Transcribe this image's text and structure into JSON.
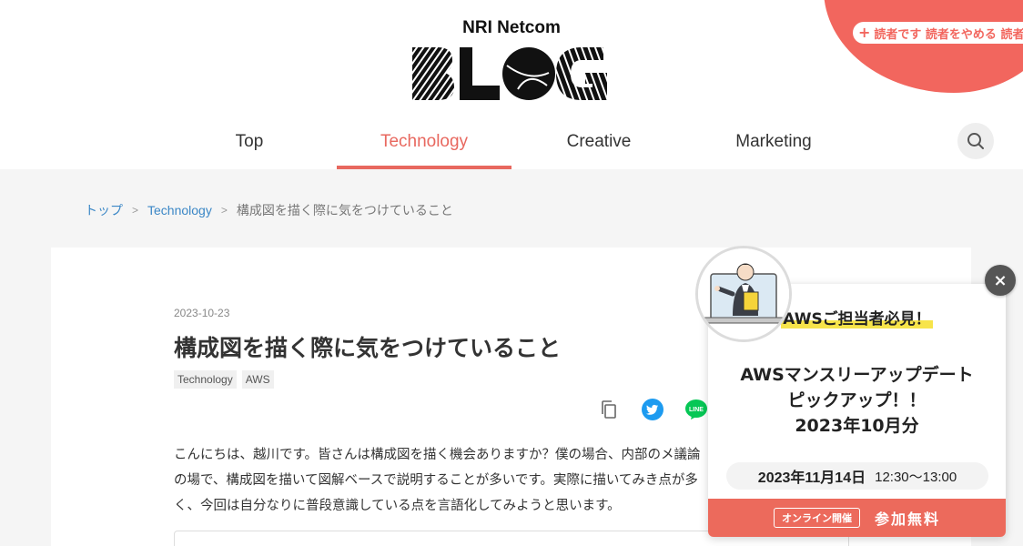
{
  "header": {
    "brand_name": "NRI Netcom",
    "logo_text": "BLOG",
    "reader_button": "読者です 読者をやめる 読者"
  },
  "nav": {
    "items": [
      {
        "label": "Top"
      },
      {
        "label": "Technology",
        "active": true
      },
      {
        "label": "Creative"
      },
      {
        "label": "Marketing"
      }
    ]
  },
  "breadcrumb": {
    "items": [
      "トップ",
      "Technology"
    ],
    "separator": ">",
    "current": "構成図を描く際に気をつけていること"
  },
  "article": {
    "date": "2023-10-23",
    "title": "構成図を描く際に気をつけていること",
    "tags": [
      "Technology",
      "AWS"
    ],
    "body": "こんにちは、越川です。皆さんは構成図を描く機会ありますか？僕の場合、内部のメ議論の場で、構成図を描いて図解ベースで説明することが多いです。実際に描いてみき点が多く、今回は自分なりに普段意識している点を言語化してみようと思います。",
    "share_icons": [
      "copy-icon",
      "twitter-icon",
      "line-icon"
    ],
    "line_label": "LINE"
  },
  "popup": {
    "kicker": "AWSご担当者必見！",
    "title_lines": [
      "AWSマンスリーアップデート",
      "ピックアップ！！",
      "2023年10月分"
    ],
    "date": "2023年11月14日",
    "time": "12:30〜13:00",
    "online_badge": "オンライン開催",
    "cta": "参加無料",
    "close_label": "×"
  },
  "colors": {
    "accent": "#e8685f",
    "link": "#3b87c6",
    "popup_footer": "#ec6a5c",
    "highlight": "#f7e44a",
    "twitter": "#1d9bf0",
    "line": "#06c755"
  }
}
